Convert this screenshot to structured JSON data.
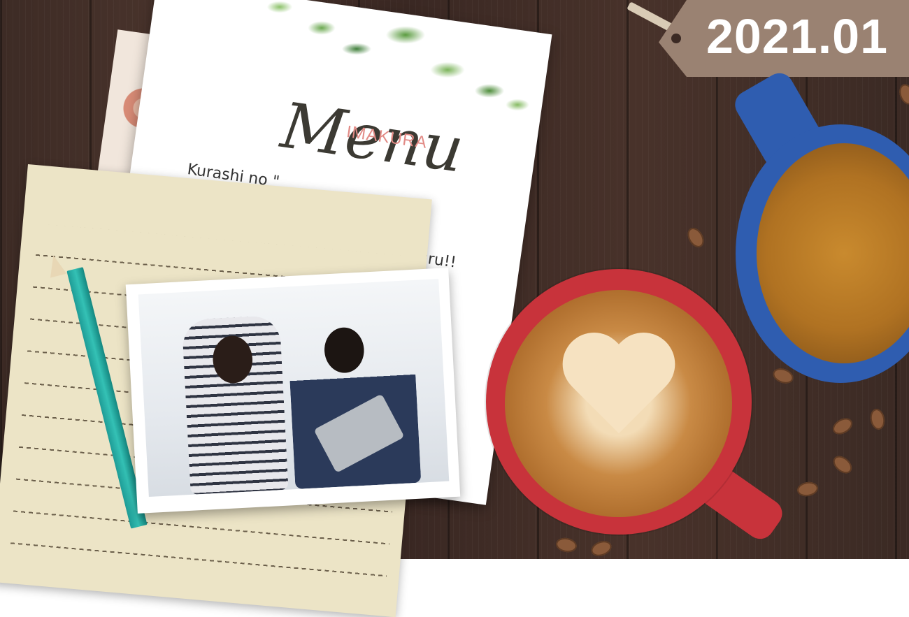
{
  "date_tag": {
    "label": "2021.01"
  },
  "menu_card": {
    "title": "Menu",
    "brand": "IMAKURA",
    "subtitle": "Kurashi no \"",
    "subtitle_end": "uru!!"
  },
  "colors": {
    "table": "#3b2a24",
    "tag": "#9a8272",
    "brand_pink": "#e28b86",
    "red_cup": "#c8333b",
    "blue_cup": "#2f5db0",
    "pencil": "#1e9c96"
  }
}
